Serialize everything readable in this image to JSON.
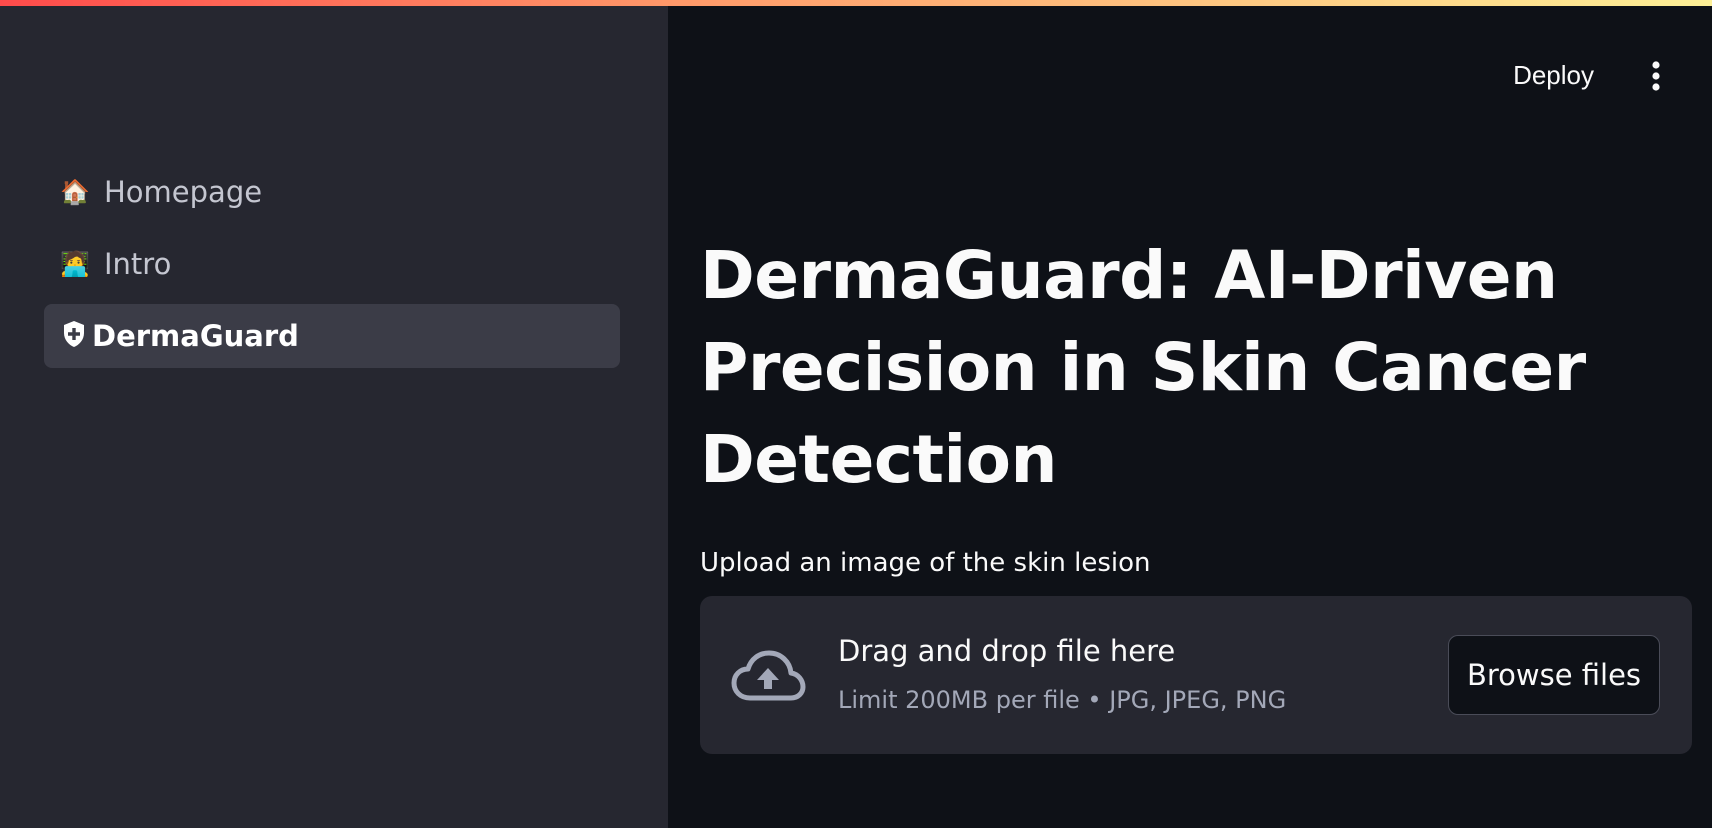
{
  "sidebar": {
    "items": [
      {
        "icon": "house-icon",
        "glyph": "🏠",
        "label": "Homepage",
        "active": false
      },
      {
        "icon": "technologist-icon",
        "glyph": "🧑‍💻",
        "label": "Intro",
        "active": false
      },
      {
        "icon": "shield-plus-icon",
        "glyph": "⛨",
        "label": "DermaGuard",
        "active": true
      }
    ]
  },
  "header": {
    "deploy_label": "Deploy",
    "menu_icon": "vertical-ellipsis-icon"
  },
  "main": {
    "title": "DermaGuard: AI-Driven Precision in Skin Cancer Detection",
    "uploader": {
      "label": "Upload an image of the skin lesion",
      "icon": "cloud-upload-icon",
      "drop_text": "Drag and drop file here",
      "limit_text": "Limit 200MB per file • JPG, JPEG, PNG",
      "browse_label": "Browse files"
    }
  },
  "colors": {
    "background": "#0e1117",
    "sidebar": "#262730",
    "active_item": "#3b3c47",
    "accent_gradient_start": "#ff4b4b",
    "accent_gradient_end": "#fdf097"
  }
}
